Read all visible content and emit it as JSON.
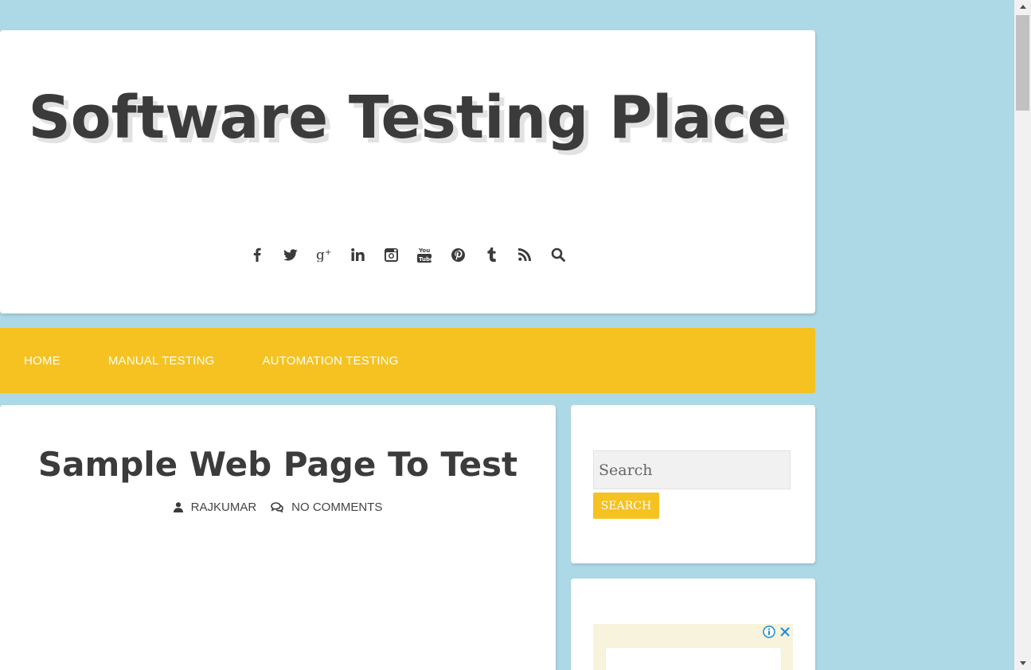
{
  "header": {
    "site_title": "Software Testing Place",
    "social_icons": [
      "facebook-icon",
      "twitter-icon",
      "google-plus-icon",
      "linkedin-icon",
      "instagram-icon",
      "youtube-icon",
      "pinterest-icon",
      "tumblr-icon",
      "rss-icon",
      "search-icon"
    ]
  },
  "nav": {
    "items": [
      {
        "label": "HOME"
      },
      {
        "label": "MANUAL TESTING"
      },
      {
        "label": "AUTOMATION TESTING"
      }
    ]
  },
  "post": {
    "title": "Sample Web Page To Test",
    "author": "RAJKUMAR",
    "comments": "NO COMMENTS"
  },
  "sidebar": {
    "search_placeholder": "Search",
    "search_button": "SEARCH"
  },
  "colors": {
    "background": "#add8e6",
    "accent": "#f5c221",
    "text_dark": "#3b3b3b"
  }
}
